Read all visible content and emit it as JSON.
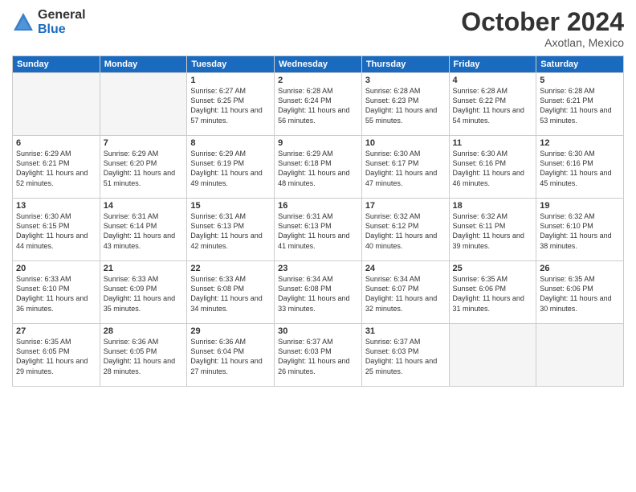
{
  "logo": {
    "general": "General",
    "blue": "Blue"
  },
  "header": {
    "month": "October 2024",
    "location": "Axotlan, Mexico"
  },
  "days": [
    "Sunday",
    "Monday",
    "Tuesday",
    "Wednesday",
    "Thursday",
    "Friday",
    "Saturday"
  ],
  "weeks": [
    [
      {
        "day": "",
        "empty": true
      },
      {
        "day": "",
        "empty": true
      },
      {
        "day": "1",
        "sunrise": "Sunrise: 6:27 AM",
        "sunset": "Sunset: 6:25 PM",
        "daylight": "Daylight: 11 hours and 57 minutes."
      },
      {
        "day": "2",
        "sunrise": "Sunrise: 6:28 AM",
        "sunset": "Sunset: 6:24 PM",
        "daylight": "Daylight: 11 hours and 56 minutes."
      },
      {
        "day": "3",
        "sunrise": "Sunrise: 6:28 AM",
        "sunset": "Sunset: 6:23 PM",
        "daylight": "Daylight: 11 hours and 55 minutes."
      },
      {
        "day": "4",
        "sunrise": "Sunrise: 6:28 AM",
        "sunset": "Sunset: 6:22 PM",
        "daylight": "Daylight: 11 hours and 54 minutes."
      },
      {
        "day": "5",
        "sunrise": "Sunrise: 6:28 AM",
        "sunset": "Sunset: 6:21 PM",
        "daylight": "Daylight: 11 hours and 53 minutes."
      }
    ],
    [
      {
        "day": "6",
        "sunrise": "Sunrise: 6:29 AM",
        "sunset": "Sunset: 6:21 PM",
        "daylight": "Daylight: 11 hours and 52 minutes."
      },
      {
        "day": "7",
        "sunrise": "Sunrise: 6:29 AM",
        "sunset": "Sunset: 6:20 PM",
        "daylight": "Daylight: 11 hours and 51 minutes."
      },
      {
        "day": "8",
        "sunrise": "Sunrise: 6:29 AM",
        "sunset": "Sunset: 6:19 PM",
        "daylight": "Daylight: 11 hours and 49 minutes."
      },
      {
        "day": "9",
        "sunrise": "Sunrise: 6:29 AM",
        "sunset": "Sunset: 6:18 PM",
        "daylight": "Daylight: 11 hours and 48 minutes."
      },
      {
        "day": "10",
        "sunrise": "Sunrise: 6:30 AM",
        "sunset": "Sunset: 6:17 PM",
        "daylight": "Daylight: 11 hours and 47 minutes."
      },
      {
        "day": "11",
        "sunrise": "Sunrise: 6:30 AM",
        "sunset": "Sunset: 6:16 PM",
        "daylight": "Daylight: 11 hours and 46 minutes."
      },
      {
        "day": "12",
        "sunrise": "Sunrise: 6:30 AM",
        "sunset": "Sunset: 6:16 PM",
        "daylight": "Daylight: 11 hours and 45 minutes."
      }
    ],
    [
      {
        "day": "13",
        "sunrise": "Sunrise: 6:30 AM",
        "sunset": "Sunset: 6:15 PM",
        "daylight": "Daylight: 11 hours and 44 minutes."
      },
      {
        "day": "14",
        "sunrise": "Sunrise: 6:31 AM",
        "sunset": "Sunset: 6:14 PM",
        "daylight": "Daylight: 11 hours and 43 minutes."
      },
      {
        "day": "15",
        "sunrise": "Sunrise: 6:31 AM",
        "sunset": "Sunset: 6:13 PM",
        "daylight": "Daylight: 11 hours and 42 minutes."
      },
      {
        "day": "16",
        "sunrise": "Sunrise: 6:31 AM",
        "sunset": "Sunset: 6:13 PM",
        "daylight": "Daylight: 11 hours and 41 minutes."
      },
      {
        "day": "17",
        "sunrise": "Sunrise: 6:32 AM",
        "sunset": "Sunset: 6:12 PM",
        "daylight": "Daylight: 11 hours and 40 minutes."
      },
      {
        "day": "18",
        "sunrise": "Sunrise: 6:32 AM",
        "sunset": "Sunset: 6:11 PM",
        "daylight": "Daylight: 11 hours and 39 minutes."
      },
      {
        "day": "19",
        "sunrise": "Sunrise: 6:32 AM",
        "sunset": "Sunset: 6:10 PM",
        "daylight": "Daylight: 11 hours and 38 minutes."
      }
    ],
    [
      {
        "day": "20",
        "sunrise": "Sunrise: 6:33 AM",
        "sunset": "Sunset: 6:10 PM",
        "daylight": "Daylight: 11 hours and 36 minutes."
      },
      {
        "day": "21",
        "sunrise": "Sunrise: 6:33 AM",
        "sunset": "Sunset: 6:09 PM",
        "daylight": "Daylight: 11 hours and 35 minutes."
      },
      {
        "day": "22",
        "sunrise": "Sunrise: 6:33 AM",
        "sunset": "Sunset: 6:08 PM",
        "daylight": "Daylight: 11 hours and 34 minutes."
      },
      {
        "day": "23",
        "sunrise": "Sunrise: 6:34 AM",
        "sunset": "Sunset: 6:08 PM",
        "daylight": "Daylight: 11 hours and 33 minutes."
      },
      {
        "day": "24",
        "sunrise": "Sunrise: 6:34 AM",
        "sunset": "Sunset: 6:07 PM",
        "daylight": "Daylight: 11 hours and 32 minutes."
      },
      {
        "day": "25",
        "sunrise": "Sunrise: 6:35 AM",
        "sunset": "Sunset: 6:06 PM",
        "daylight": "Daylight: 11 hours and 31 minutes."
      },
      {
        "day": "26",
        "sunrise": "Sunrise: 6:35 AM",
        "sunset": "Sunset: 6:06 PM",
        "daylight": "Daylight: 11 hours and 30 minutes."
      }
    ],
    [
      {
        "day": "27",
        "sunrise": "Sunrise: 6:35 AM",
        "sunset": "Sunset: 6:05 PM",
        "daylight": "Daylight: 11 hours and 29 minutes."
      },
      {
        "day": "28",
        "sunrise": "Sunrise: 6:36 AM",
        "sunset": "Sunset: 6:05 PM",
        "daylight": "Daylight: 11 hours and 28 minutes."
      },
      {
        "day": "29",
        "sunrise": "Sunrise: 6:36 AM",
        "sunset": "Sunset: 6:04 PM",
        "daylight": "Daylight: 11 hours and 27 minutes."
      },
      {
        "day": "30",
        "sunrise": "Sunrise: 6:37 AM",
        "sunset": "Sunset: 6:03 PM",
        "daylight": "Daylight: 11 hours and 26 minutes."
      },
      {
        "day": "31",
        "sunrise": "Sunrise: 6:37 AM",
        "sunset": "Sunset: 6:03 PM",
        "daylight": "Daylight: 11 hours and 25 minutes."
      },
      {
        "day": "",
        "empty": true
      },
      {
        "day": "",
        "empty": true
      }
    ]
  ]
}
